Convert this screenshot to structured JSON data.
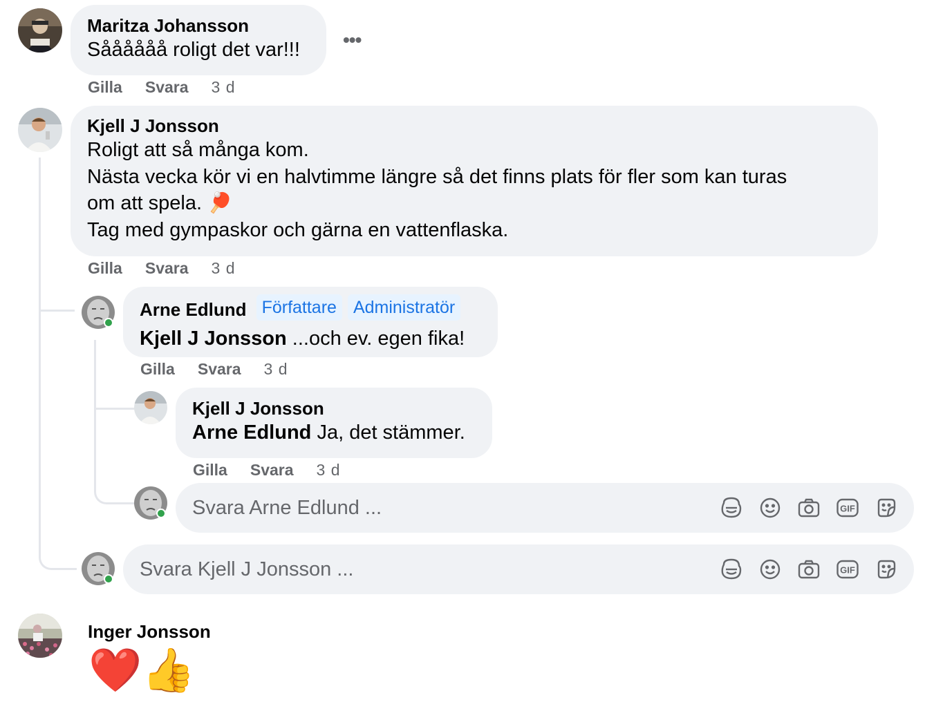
{
  "comments": [
    {
      "author": "Maritza Johansson",
      "text": "Såååååå roligt det var!!!",
      "like": "Gilla",
      "reply": "Svara",
      "time": "3 d"
    },
    {
      "author": "Kjell J Jonsson",
      "lines": [
        "Roligt att så många kom.",
        "Nästa vecka kör vi en halvtimme längre så det finns plats för fler som kan turas",
        "om att spela. 🏓",
        "Tag med gympaskor och gärna en vattenflaska."
      ],
      "like": "Gilla",
      "reply": "Svara",
      "time": "3 d",
      "replies": [
        {
          "author": "Arne Edlund",
          "badges": [
            "Författare",
            "Administratör"
          ],
          "mention": "Kjell J Jonsson",
          "text": " ...och ev. egen fika!",
          "like": "Gilla",
          "reply": "Svara",
          "time": "3 d",
          "replies": [
            {
              "author": "Kjell J Jonsson",
              "mention": "Arne Edlund",
              "text": " Ja, det stämmer.",
              "like": "Gilla",
              "reply": "Svara",
              "time": "3 d"
            }
          ],
          "reply_box": {
            "placeholder": "Svara Arne Edlund ..."
          }
        }
      ],
      "reply_box": {
        "placeholder": "Svara Kjell J Jonsson ..."
      }
    },
    {
      "author": "Inger Jonsson",
      "emojis": "❤️👍"
    }
  ],
  "more_icon": "•••",
  "composer_icons": [
    "avatar-sticker-icon",
    "emoji-icon",
    "camera-icon",
    "gif-icon",
    "sticker-icon"
  ],
  "gif_label": "GIF",
  "colors": {
    "bubble": "#f0f2f5",
    "meta_text": "#65676b",
    "badge_bg": "#e7f3ff",
    "badge_text": "#1b74e4",
    "online": "#31a24c"
  }
}
